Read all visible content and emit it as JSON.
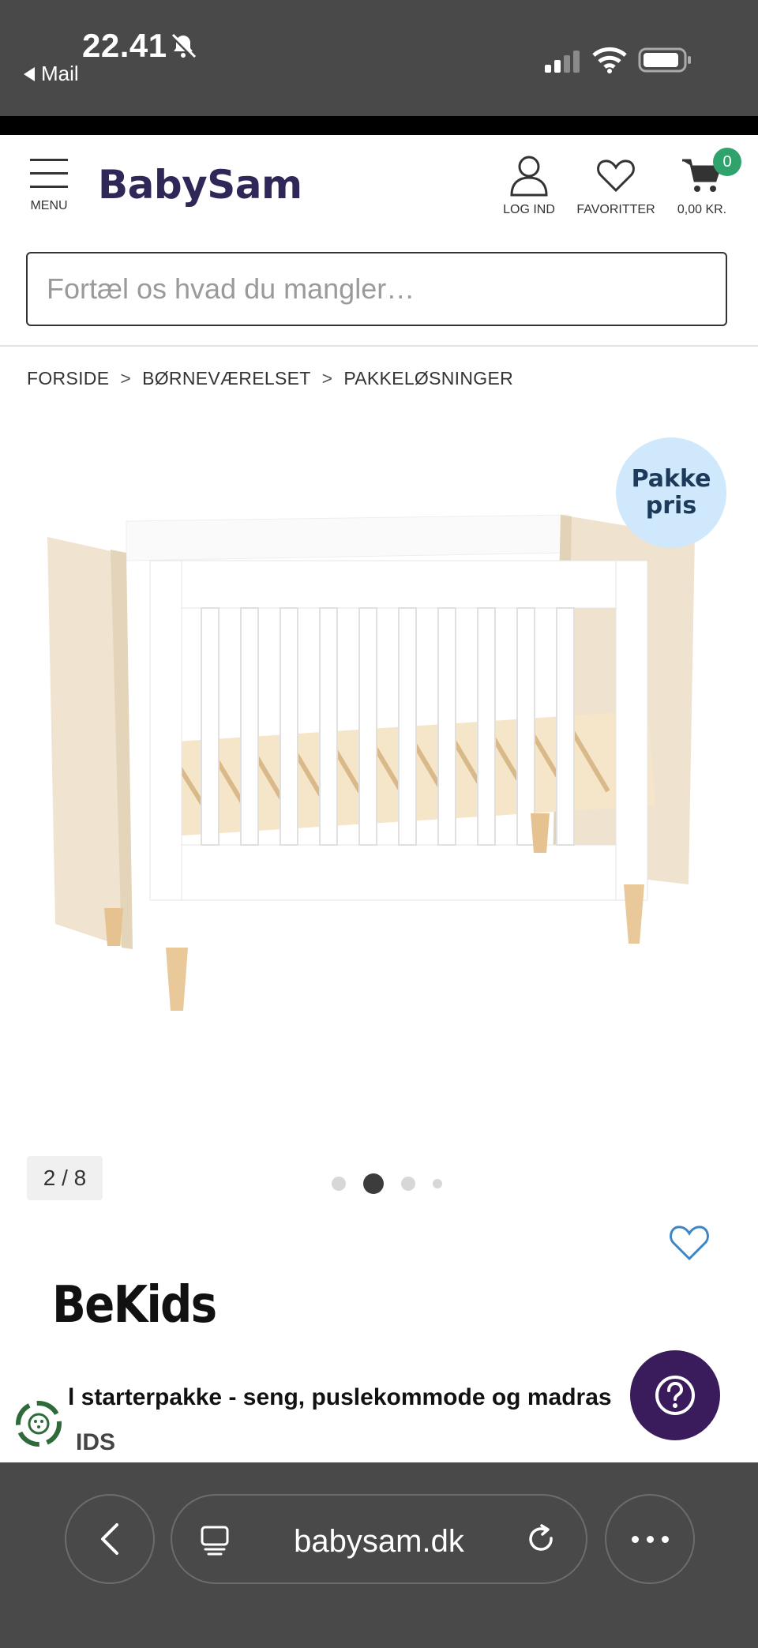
{
  "status_bar": {
    "time": "22.41",
    "back_app": "Mail"
  },
  "header": {
    "brand": "BabySam",
    "menu_label": "MENU",
    "login_label": "LOG IND",
    "favorites_label": "FAVORITTER",
    "cart_label": "0,00 KR.",
    "cart_count": "0"
  },
  "search": {
    "placeholder": "Fortæl os hvad du mangler…"
  },
  "breadcrumb": {
    "items": [
      "FORSIDE",
      "BØRNEVÆRELSET",
      "PAKKELØSNINGER"
    ],
    "separator": ">"
  },
  "gallery": {
    "badge_line1": "Pakke",
    "badge_line2": "pris",
    "counter": "2 / 8",
    "dots_total": 4,
    "active_dot": 2
  },
  "product": {
    "brand_logo": "BeKids",
    "title": "l starterpakke - seng, puslekommode og madras",
    "brand_partial": "IDS"
  },
  "browser": {
    "url": "babysam.dk"
  },
  "colors": {
    "brand": "#2f2757",
    "cart_badge": "#2fa36b",
    "help_button": "#3a1c5c",
    "badge_bg": "#cfe8fb",
    "fav_outline": "#3b86c6"
  }
}
